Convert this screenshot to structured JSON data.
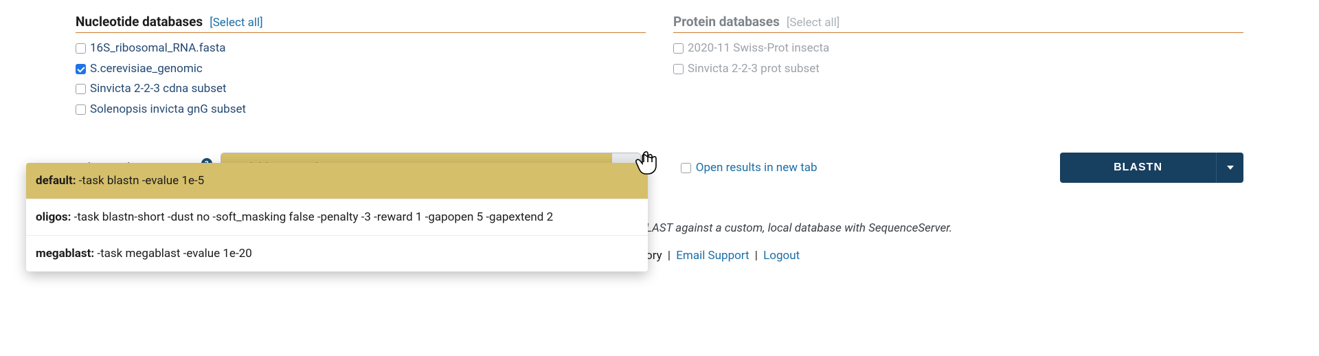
{
  "nucleotide": {
    "heading": "Nucleotide databases",
    "select_all": "[Select all]",
    "items": [
      {
        "label": "16S_ribosomal_RNA.fasta",
        "checked": false
      },
      {
        "label": "S.cerevisiae_genomic",
        "checked": true
      },
      {
        "label": "Sinvicta 2-2-3 cdna subset",
        "checked": false
      },
      {
        "label": "Solenopsis invicta gnG subset",
        "checked": false
      }
    ]
  },
  "protein": {
    "heading": "Protein databases",
    "select_all": "[Select all]",
    "items": [
      {
        "label": "2020-11 Swiss-Prot insecta",
        "checked": false
      },
      {
        "label": "Sinvicta 2-2-3 prot subset",
        "checked": false
      }
    ]
  },
  "advanced": {
    "label": "Advanced parameters:",
    "value": "-task blastn -evalue 1e-5",
    "options": [
      {
        "name": "default:",
        "value": "-task blastn -evalue 1e-5",
        "selected": true
      },
      {
        "name": "oligos:",
        "value": "-task blastn-short -dust no -soft_masking false -penalty -3 -reward 1 -gapopen 5 -gapextend 2",
        "selected": false
      },
      {
        "name": "megablast:",
        "value": "-task megablast -evalue 1e-20",
        "selected": false
      }
    ]
  },
  "new_tab": {
    "label": "Open results in new tab",
    "checked": false
  },
  "blast_button": "BLASTN",
  "footer": {
    "tagline_suffix": "LAST against a custom, local database with SequenceServer.",
    "history_suffix": "ory",
    "email_support": "Email Support",
    "logout": "Logout"
  }
}
